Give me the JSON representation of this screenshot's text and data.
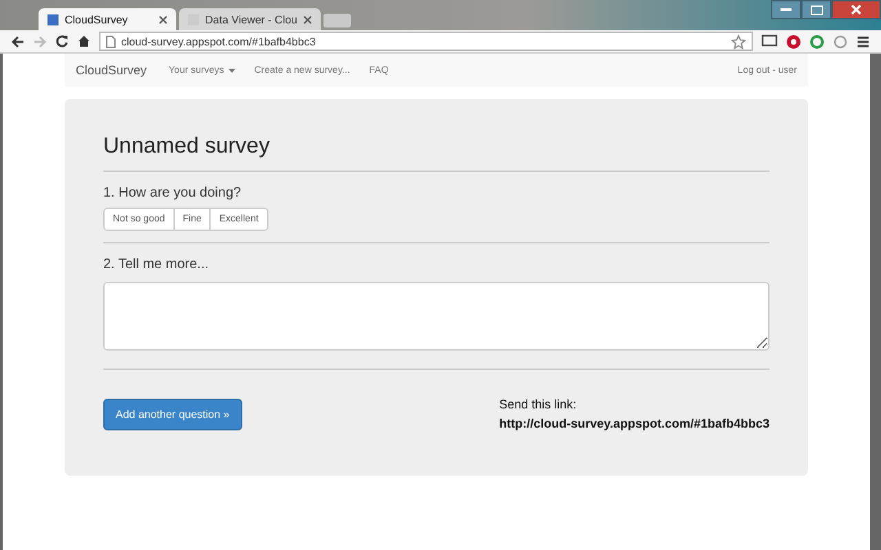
{
  "browser": {
    "tabs": [
      {
        "title": "CloudSurvey",
        "selected": true
      },
      {
        "title": "Data Viewer - Clou",
        "selected": false
      }
    ],
    "address": "cloud-survey.appspot.com/#1bafb4bbc3"
  },
  "navbar": {
    "brand": "CloudSurvey",
    "links": [
      {
        "label": "Your surveys",
        "dropdown": true
      },
      {
        "label": "Create a new survey...",
        "dropdown": false
      },
      {
        "label": "FAQ",
        "dropdown": false
      }
    ],
    "account": "Log out - user"
  },
  "survey": {
    "title": "Unnamed survey",
    "questions": [
      {
        "kind": "choice",
        "label": "1. How are you doing?",
        "options": [
          "Not so good",
          "Fine",
          "Excellent"
        ]
      },
      {
        "kind": "text",
        "label": "2. Tell me more..."
      }
    ],
    "add_button": "Add another question »",
    "send_label": "Send this link:",
    "send_link": "http://cloud-survey.appspot.com/#1bafb4bbc3"
  }
}
